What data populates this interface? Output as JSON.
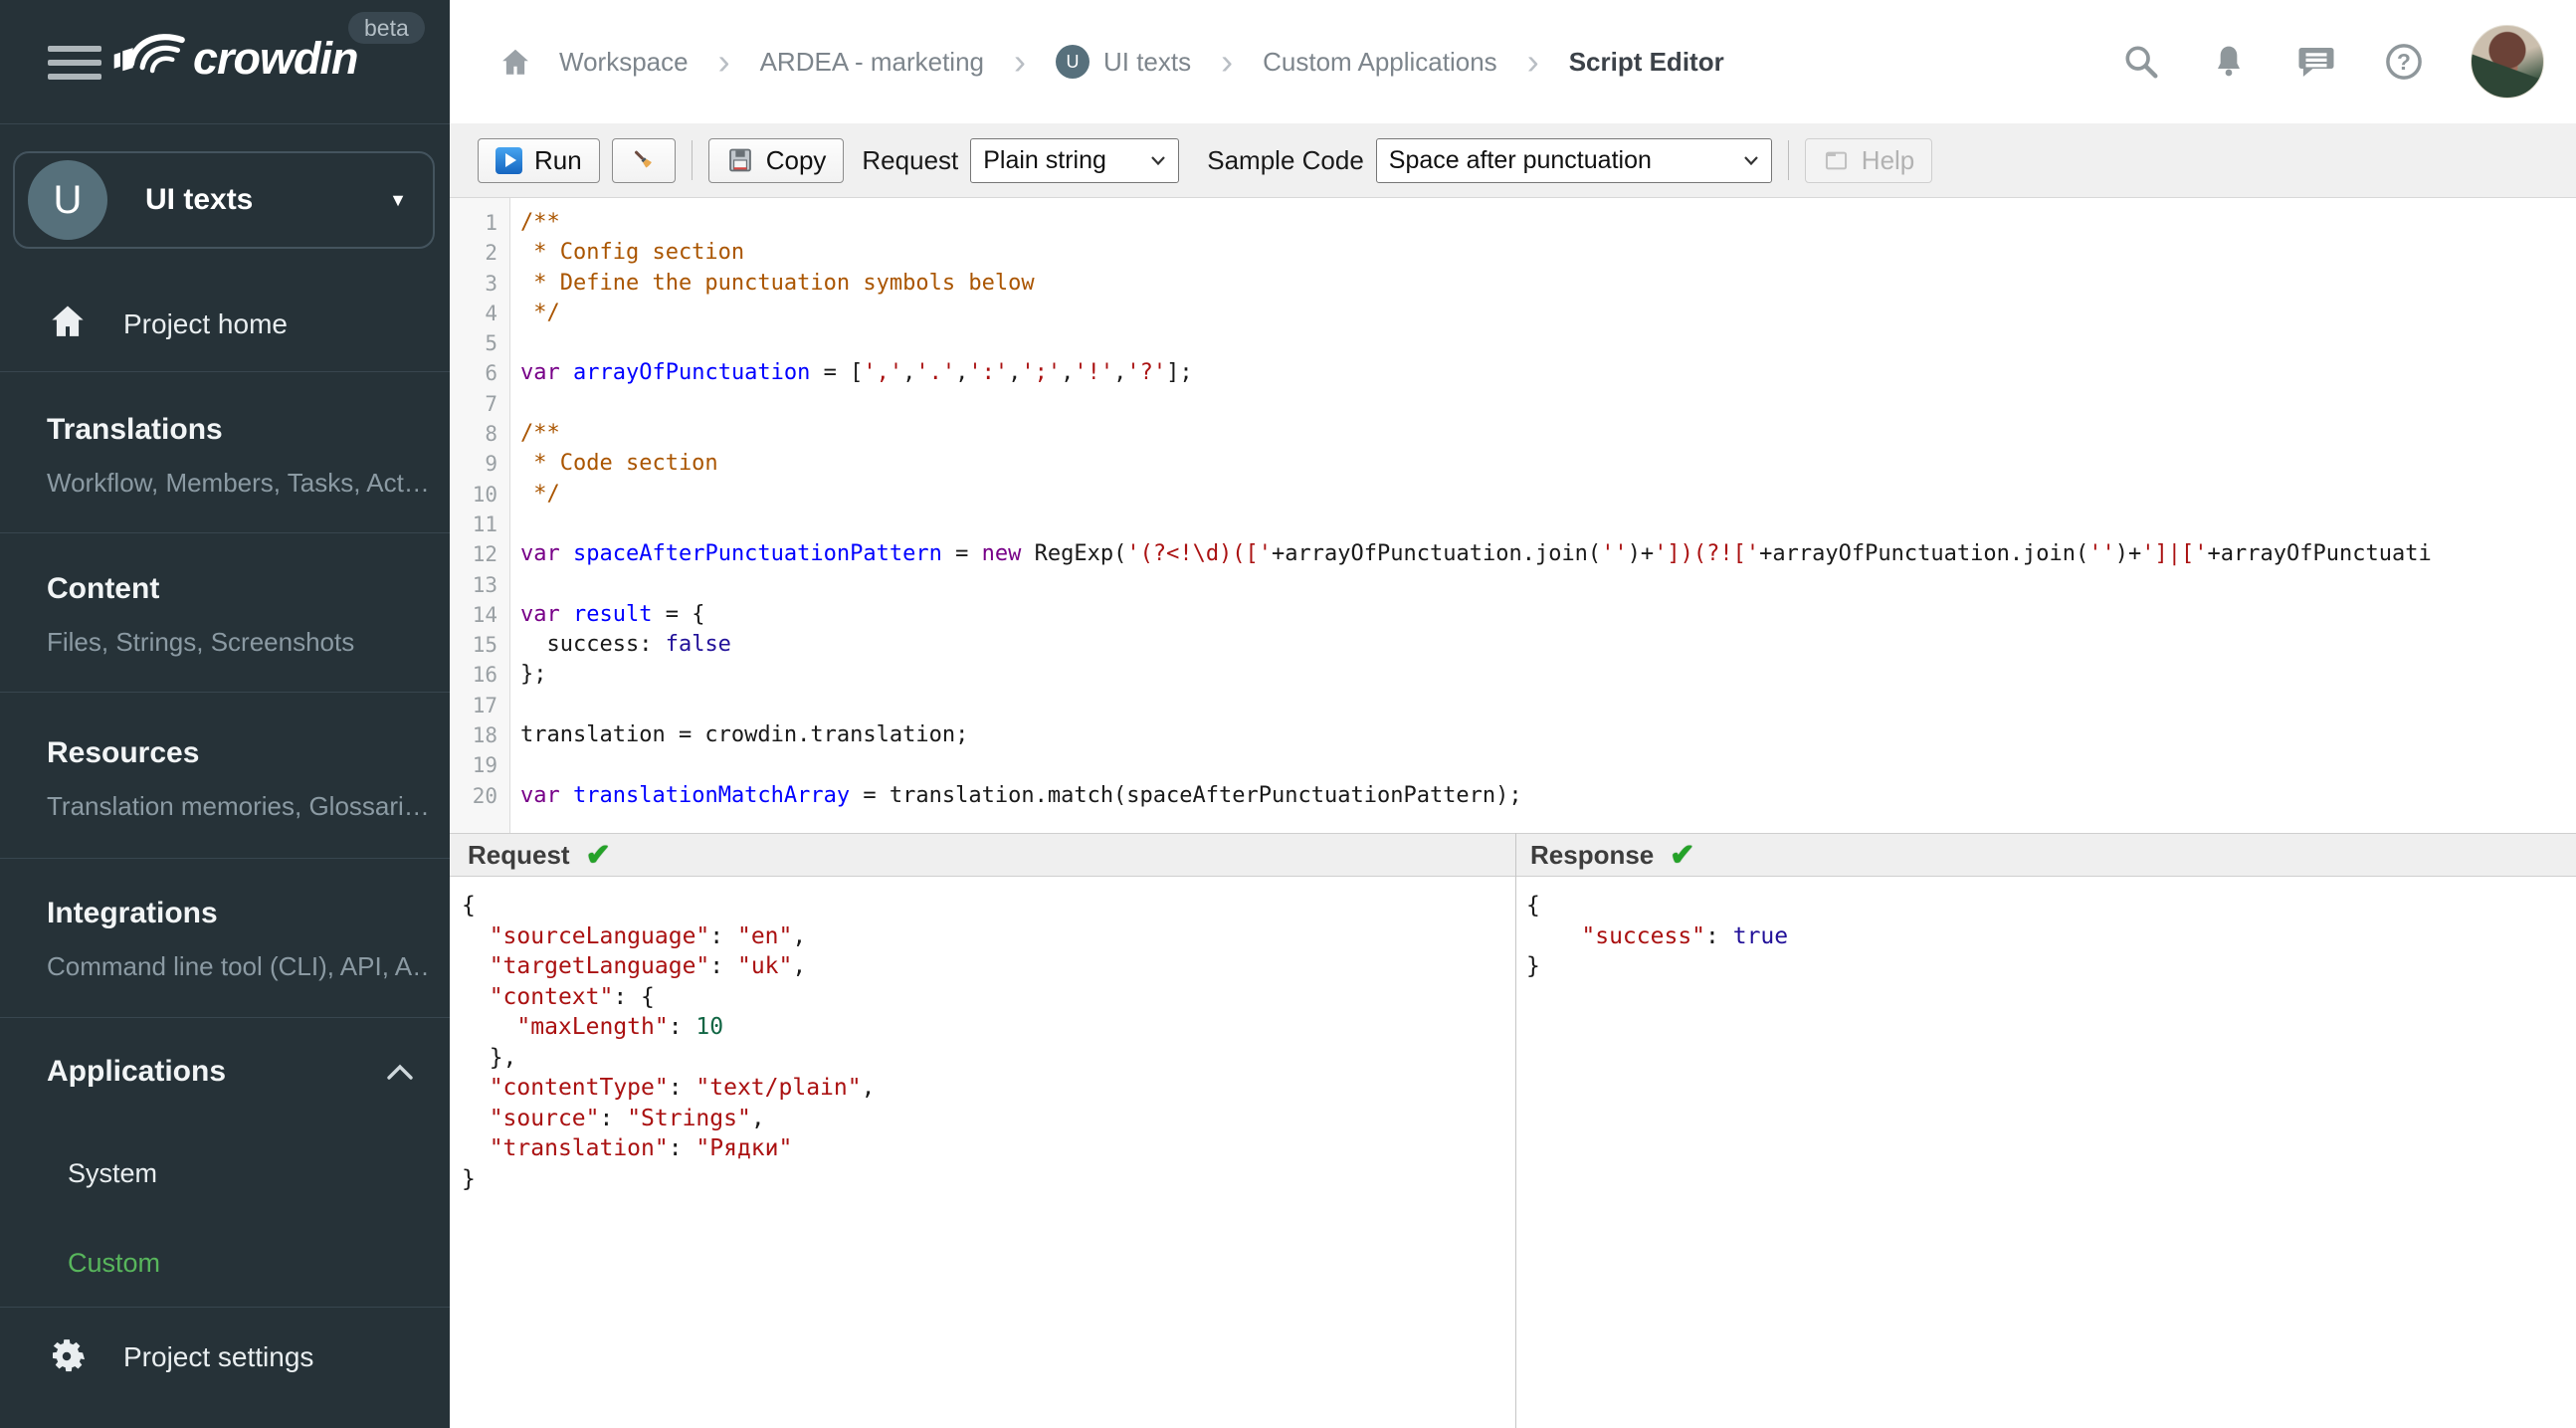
{
  "brand": {
    "name": "crowdin",
    "beta": "beta"
  },
  "colors": {
    "sidebar_bg": "#263238",
    "accent_green": "#58b65c",
    "run_icon_blue": "#1565c0",
    "check_green": "#24a228"
  },
  "icons": {
    "check": "✔",
    "caret_down": "▼",
    "breadcrumb_separator": "›"
  },
  "project": {
    "initial": "U",
    "name": "UI texts"
  },
  "sidebar": {
    "home_label": "Project home",
    "sections": [
      {
        "title": "Translations",
        "subtitle": "Workflow, Members, Tasks, Act…"
      },
      {
        "title": "Content",
        "subtitle": "Files, Strings, Screenshots"
      },
      {
        "title": "Resources",
        "subtitle": "Translation memories, Glossari…"
      },
      {
        "title": "Integrations",
        "subtitle": "Command line tool (CLI), API, A…"
      }
    ],
    "applications": {
      "title": "Applications",
      "items": [
        {
          "label": "System",
          "active": false
        },
        {
          "label": "Custom",
          "active": true
        }
      ]
    },
    "settings_label": "Project settings"
  },
  "breadcrumb": {
    "separator": "›",
    "items": [
      {
        "label": "Workspace"
      },
      {
        "label": "ARDEA - marketing"
      },
      {
        "label": "UI texts",
        "avatar": "U"
      },
      {
        "label": "Custom Applications"
      },
      {
        "label": "Script Editor",
        "current": true
      }
    ]
  },
  "toolbar": {
    "run_label": "Run",
    "copy_label": "Copy",
    "request_label": "Request",
    "request_value": "Plain string",
    "sample_code_label": "Sample Code",
    "sample_code_value": "Space after punctuation",
    "help_label": "Help"
  },
  "editor": {
    "lines": [
      {
        "n": "1",
        "t": [
          [
            "c",
            "/**"
          ]
        ]
      },
      {
        "n": "2",
        "t": [
          [
            "c",
            " * Config section"
          ]
        ]
      },
      {
        "n": "3",
        "t": [
          [
            "c",
            " * Define the punctuation symbols below"
          ]
        ]
      },
      {
        "n": "4",
        "t": [
          [
            "c",
            " */"
          ]
        ]
      },
      {
        "n": "5",
        "t": []
      },
      {
        "n": "6",
        "t": [
          [
            "k",
            "var"
          ],
          [
            "p",
            " "
          ],
          [
            "d",
            "arrayOfPunctuation"
          ],
          [
            "p",
            " = ["
          ],
          [
            "s",
            "','"
          ],
          [
            "p",
            ","
          ],
          [
            "s",
            "'.'"
          ],
          [
            "p",
            ","
          ],
          [
            "s",
            "':'"
          ],
          [
            "p",
            ","
          ],
          [
            "s",
            "';'"
          ],
          [
            "p",
            ","
          ],
          [
            "s",
            "'!'"
          ],
          [
            "p",
            ","
          ],
          [
            "s",
            "'?'"
          ],
          [
            "p",
            "];"
          ]
        ]
      },
      {
        "n": "7",
        "t": []
      },
      {
        "n": "8",
        "t": [
          [
            "c",
            "/**"
          ]
        ]
      },
      {
        "n": "9",
        "t": [
          [
            "c",
            " * Code section"
          ]
        ]
      },
      {
        "n": "10",
        "t": [
          [
            "c",
            " */"
          ]
        ]
      },
      {
        "n": "11",
        "t": []
      },
      {
        "n": "12",
        "t": [
          [
            "k",
            "var"
          ],
          [
            "p",
            " "
          ],
          [
            "d",
            "spaceAfterPunctuationPattern"
          ],
          [
            "p",
            " = "
          ],
          [
            "k",
            "new"
          ],
          [
            "p",
            " RegExp("
          ],
          [
            "s",
            "'(?<!\\d)(['"
          ],
          [
            "p",
            "+arrayOfPunctuation.join("
          ],
          [
            "s",
            "''"
          ],
          [
            "p",
            ")+"
          ],
          [
            "s",
            "'])(?!['"
          ],
          [
            "p",
            "+arrayOfPunctuation.join("
          ],
          [
            "s",
            "''"
          ],
          [
            "p",
            ")+"
          ],
          [
            "s",
            "']|['"
          ],
          [
            "p",
            "+arrayOfPunctuati"
          ]
        ]
      },
      {
        "n": "13",
        "t": []
      },
      {
        "n": "14",
        "t": [
          [
            "k",
            "var"
          ],
          [
            "p",
            " "
          ],
          [
            "d",
            "result"
          ],
          [
            "p",
            " = {"
          ]
        ]
      },
      {
        "n": "15",
        "t": [
          [
            "p",
            "  success: "
          ],
          [
            "a",
            "false"
          ]
        ]
      },
      {
        "n": "16",
        "t": [
          [
            "p",
            "};"
          ]
        ]
      },
      {
        "n": "17",
        "t": []
      },
      {
        "n": "18",
        "t": [
          [
            "p",
            "translation = crowdin.translation;"
          ]
        ]
      },
      {
        "n": "19",
        "t": []
      },
      {
        "n": "20",
        "t": [
          [
            "k",
            "var"
          ],
          [
            "p",
            " "
          ],
          [
            "d",
            "translationMatchArray"
          ],
          [
            "p",
            " = translation.match(spaceAfterPunctuationPattern);"
          ]
        ]
      }
    ]
  },
  "panels": {
    "request": {
      "title": "Request",
      "status_icon": "✔",
      "lines": [
        [
          [
            "p",
            "{"
          ]
        ],
        [
          [
            "p",
            "  "
          ],
          [
            "s",
            "\"sourceLanguage\""
          ],
          [
            "p",
            ": "
          ],
          [
            "s",
            "\"en\""
          ],
          [
            "p",
            ","
          ]
        ],
        [
          [
            "p",
            "  "
          ],
          [
            "s",
            "\"targetLanguage\""
          ],
          [
            "p",
            ": "
          ],
          [
            "s",
            "\"uk\""
          ],
          [
            "p",
            ","
          ]
        ],
        [
          [
            "p",
            "  "
          ],
          [
            "s",
            "\"context\""
          ],
          [
            "p",
            ": {"
          ]
        ],
        [
          [
            "p",
            "    "
          ],
          [
            "s",
            "\"maxLength\""
          ],
          [
            "p",
            ": "
          ],
          [
            "n",
            "10"
          ]
        ],
        [
          [
            "p",
            "  },"
          ]
        ],
        [
          [
            "p",
            "  "
          ],
          [
            "s",
            "\"contentType\""
          ],
          [
            "p",
            ": "
          ],
          [
            "s",
            "\"text/plain\""
          ],
          [
            "p",
            ","
          ]
        ],
        [
          [
            "p",
            "  "
          ],
          [
            "s",
            "\"source\""
          ],
          [
            "p",
            ": "
          ],
          [
            "s",
            "\"Strings\""
          ],
          [
            "p",
            ","
          ]
        ],
        [
          [
            "p",
            "  "
          ],
          [
            "s",
            "\"translation\""
          ],
          [
            "p",
            ": "
          ],
          [
            "s",
            "\"Рядки\""
          ]
        ],
        [
          [
            "p",
            "}"
          ]
        ]
      ]
    },
    "response": {
      "title": "Response",
      "status_icon": "✔",
      "lines": [
        [
          [
            "p",
            "{"
          ]
        ],
        [
          [
            "p",
            "    "
          ],
          [
            "s",
            "\"success\""
          ],
          [
            "p",
            ": "
          ],
          [
            "a",
            "true"
          ]
        ],
        [
          [
            "p",
            "}"
          ]
        ]
      ]
    }
  }
}
